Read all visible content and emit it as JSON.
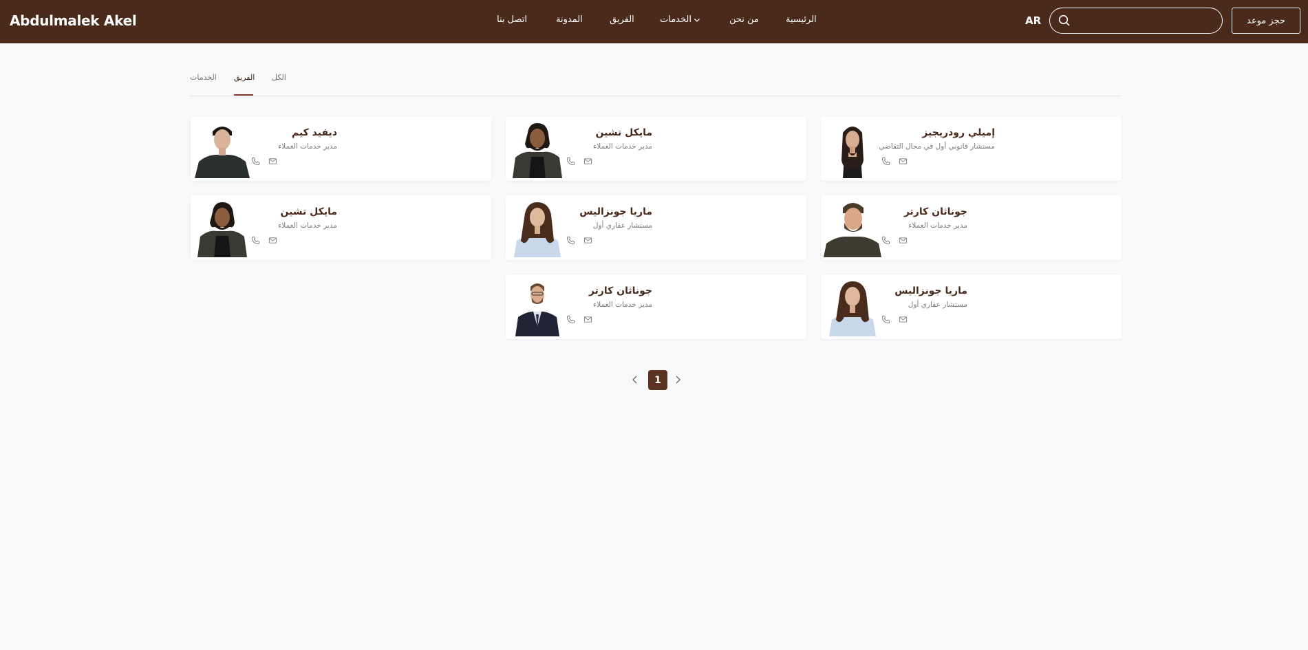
{
  "header": {
    "brand": "Abdulmalek Akel",
    "nav": {
      "home": "الرئيسية",
      "about": "من نحن",
      "services": "الخدمات",
      "team": "الفريق",
      "blog": "المدونة",
      "contact": "اتصل بنا"
    },
    "lang": "AR",
    "search": {
      "placeholder": "",
      "value": ""
    },
    "book_label": "حجز موعد"
  },
  "tabs": [
    {
      "label": "الكل"
    },
    {
      "label": "الفريق",
      "active": true
    },
    {
      "label": "الخدمات"
    }
  ],
  "cards": [
    {
      "name": "إميلي رودريجيز",
      "role": "مستشار قانوني أول في مجال التقاضي"
    },
    {
      "name": "مايكل تشين",
      "role": "مدير خدمات العملاء"
    },
    {
      "name": "ديفيد كيم",
      "role": "مدير خدمات العملاء"
    },
    {
      "name": "جوناثان كارتر",
      "role": "مدير خدمات العملاء"
    },
    {
      "name": "ماريا جونزاليس",
      "role": "مستشار عقاري أول"
    },
    {
      "name": "مايكل تشين",
      "role": "مدير خدمات العملاء"
    },
    {
      "name": "ماريا جونزاليس",
      "role": "مستشار عقاري أول"
    },
    {
      "name": "جوناثان كارتر",
      "role": "مدير خدمات العملاء"
    }
  ],
  "pagination": {
    "current": "1"
  },
  "colors": {
    "brand": "#4a2a1a",
    "accent": "#8a3b2a",
    "background": "#f8f9fb"
  },
  "icons": [
    "search-icon",
    "chevron-down-icon",
    "phone-icon",
    "mail-icon",
    "chevron-left-icon",
    "chevron-right-icon"
  ]
}
